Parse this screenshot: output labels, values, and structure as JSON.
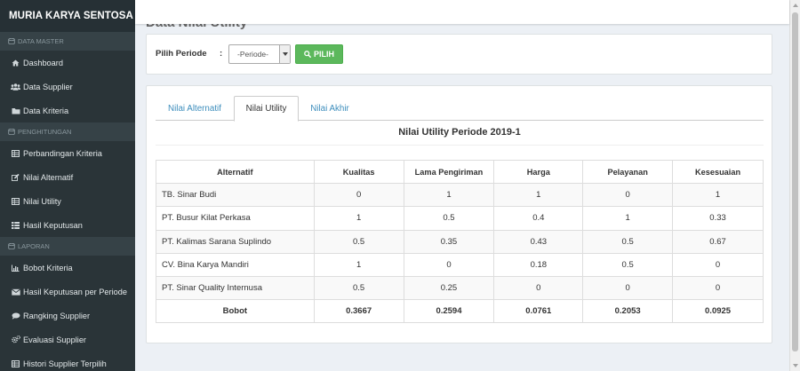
{
  "brand": "MURIA KARYA SENTOSA",
  "sidebar": {
    "sections": [
      {
        "label": "DATA MASTER",
        "icon": "database-icon",
        "items": [
          {
            "label": "Dashboard",
            "icon": "home-icon"
          },
          {
            "label": "Data Supplier",
            "icon": "users-icon"
          },
          {
            "label": "Data Kriteria",
            "icon": "folder-icon"
          }
        ]
      },
      {
        "label": "PENGHITUNGAN",
        "icon": "database-icon",
        "items": [
          {
            "label": "Perbandingan Kriteria",
            "icon": "table-icon"
          },
          {
            "label": "Nilai Alternatif",
            "icon": "edit-icon"
          },
          {
            "label": "Nilai Utility",
            "icon": "table-icon"
          },
          {
            "label": "Hasil Keputusan",
            "icon": "grid-icon"
          }
        ]
      },
      {
        "label": "LAPORAN",
        "icon": "database-icon",
        "items": [
          {
            "label": "Bobot Kriteria",
            "icon": "bar-chart-icon"
          },
          {
            "label": "Hasil Keputusan per Periode",
            "icon": "envelope-icon"
          },
          {
            "label": "Rangking Supplier",
            "icon": "comment-icon"
          },
          {
            "label": "Evaluasi Supplier",
            "icon": "cogs-icon"
          },
          {
            "label": "Histori Supplier Terpilih",
            "icon": "table-icon"
          }
        ]
      }
    ]
  },
  "page": {
    "title": "Data Nilai Utility"
  },
  "filter": {
    "label": "Pilih Periode",
    "colon": ":",
    "select_value": "-Periode-",
    "button_label": "PILIH"
  },
  "tabs": [
    {
      "label": "Nilai Alternatif",
      "active": false
    },
    {
      "label": "Nilai Utility",
      "active": true
    },
    {
      "label": "Nilai Akhir",
      "active": false
    }
  ],
  "table": {
    "title": "Nilai Utility Periode 2019-1",
    "columns": [
      "Alternatif",
      "Kualitas",
      "Lama Pengiriman",
      "Harga",
      "Pelayanan",
      "Kesesuaian"
    ],
    "rows": [
      [
        "TB. Sinar Budi",
        "0",
        "1",
        "1",
        "0",
        "1"
      ],
      [
        "PT. Busur Kilat Perkasa",
        "1",
        "0.5",
        "0.4",
        "1",
        "0.33"
      ],
      [
        "PT. Kalimas Sarana Suplindo",
        "0.5",
        "0.35",
        "0.43",
        "0.5",
        "0.67"
      ],
      [
        "CV. Bina Karya Mandiri",
        "1",
        "0",
        "0.18",
        "0.5",
        "0"
      ],
      [
        "PT. Sinar Quality Internusa",
        "0.5",
        "0.25",
        "0",
        "0",
        "0"
      ]
    ],
    "footer": [
      "Bobot",
      "0.3667",
      "0.2594",
      "0.0761",
      "0.2053",
      "0.0925"
    ]
  },
  "colors": {
    "sidebar_bg": "#2a3438",
    "link": "#3c8dbc",
    "button_green": "#5cb85c"
  }
}
